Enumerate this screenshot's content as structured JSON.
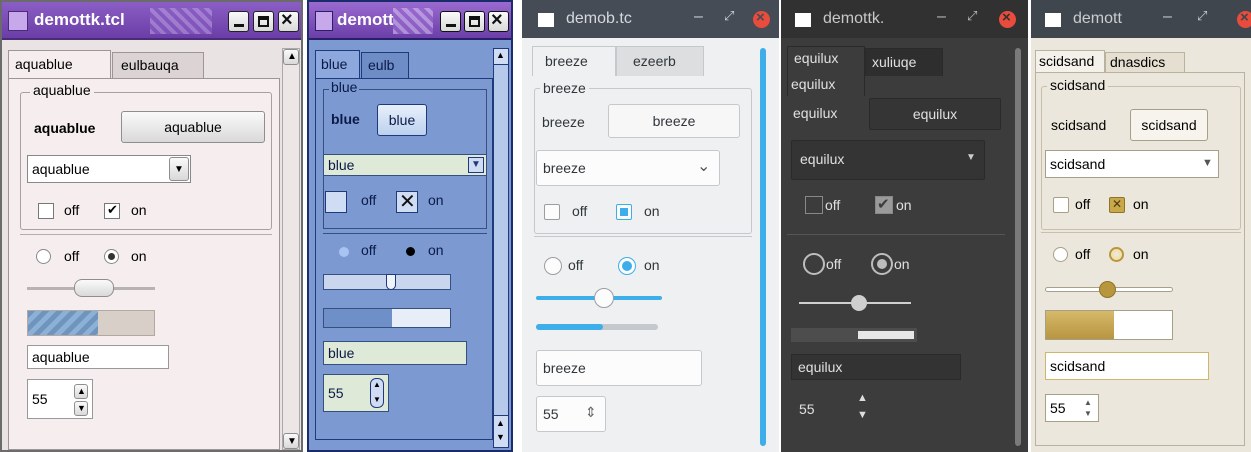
{
  "windows": [
    {
      "theme": "aquablue",
      "title": "demottk.tcl",
      "tabs": [
        "aquablue",
        "eulbauqa"
      ],
      "frame_label": "aquablue",
      "label": "aquablue",
      "button": "aquablue",
      "combobox_value": "aquablue",
      "check_off": "off",
      "check_on": "on",
      "radio_off": "off",
      "radio_on": "on",
      "scale_value": 0.5,
      "progress_value": 0.5,
      "entry_value": "aquablue",
      "spinbox_value": "55"
    },
    {
      "theme": "blue",
      "title": "demott",
      "tabs": [
        "blue",
        "eulb"
      ],
      "frame_label": "blue",
      "label": "blue",
      "button": "blue",
      "combobox_value": "blue",
      "check_off": "off",
      "check_on": "on",
      "radio_off": "off",
      "radio_on": "on",
      "scale_value": 0.5,
      "progress_value": 0.5,
      "entry_value": "blue",
      "spinbox_value": "55"
    },
    {
      "theme": "breeze",
      "title": "demob.tc",
      "tabs": [
        "breeze",
        "ezeerb"
      ],
      "frame_label": "breeze",
      "label": "breeze",
      "button": "breeze",
      "combobox_value": "breeze",
      "check_off": "off",
      "check_on": "on",
      "radio_off": "off",
      "radio_on": "on",
      "scale_value": 0.5,
      "progress_value": 0.5,
      "entry_value": "breeze",
      "spinbox_value": "55"
    },
    {
      "theme": "equilux",
      "title": "demottk.",
      "tabs": [
        "equilux",
        "xuliuqe"
      ],
      "frame_label": "equilux",
      "label": "equilux",
      "button": "equilux",
      "combobox_value": "equilux",
      "check_off": "off",
      "check_on": "on",
      "radio_off": "off",
      "radio_on": "on",
      "scale_value": 0.5,
      "progress_value": 0.5,
      "entry_value": "equilux",
      "spinbox_value": "55"
    },
    {
      "theme": "scidsand",
      "title": "demott",
      "tabs": [
        "scidsand",
        "dnasdics"
      ],
      "frame_label": "scidsand",
      "label": "scidsand",
      "button": "scidsand",
      "combobox_value": "scidsand",
      "check_off": "off",
      "check_on": "on",
      "radio_off": "off",
      "radio_on": "on",
      "scale_value": 0.5,
      "progress_value": 0.5,
      "entry_value": "scidsand",
      "spinbox_value": "55"
    }
  ],
  "icons": {
    "minimize": "minimize-icon",
    "maximize": "maximize-icon",
    "close": "close-icon",
    "check": "check-icon",
    "chevron": "chevron-down-icon",
    "spin": "spin-arrows-icon"
  },
  "colors": {
    "aquablue_titlebar": "#7a4fb8",
    "blue_bg": "#7c9ad1",
    "breeze_accent": "#3daee9",
    "equilux_bg": "#3c3c3c",
    "scidsand_accent": "#b8963e"
  }
}
